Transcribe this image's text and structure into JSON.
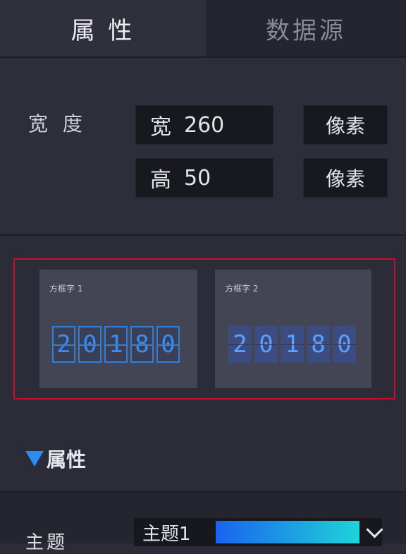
{
  "tabs": {
    "properties": "属 性",
    "datasource": "数据源"
  },
  "size": {
    "label": "宽 度",
    "width_prefix": "宽",
    "width_value": "260",
    "width_unit": "像素",
    "height_prefix": "高",
    "height_value": "50",
    "height_unit": "像素"
  },
  "styles": [
    {
      "title": "方框字 1",
      "digits": [
        "2",
        "0",
        "1",
        "8",
        "0"
      ]
    },
    {
      "title": "方框字 2",
      "digits": [
        "2",
        "0",
        "1",
        "8",
        "0"
      ]
    }
  ],
  "section": {
    "title": "属性"
  },
  "theme": {
    "label": "主题",
    "value": "主题1",
    "gradient_colors": [
      "#1a63f0",
      "#1fd3d8"
    ]
  },
  "colors": {
    "accent": "#2d8cf0",
    "selection_border": "#c8102e",
    "digit_blue": "#3b8cf0"
  }
}
